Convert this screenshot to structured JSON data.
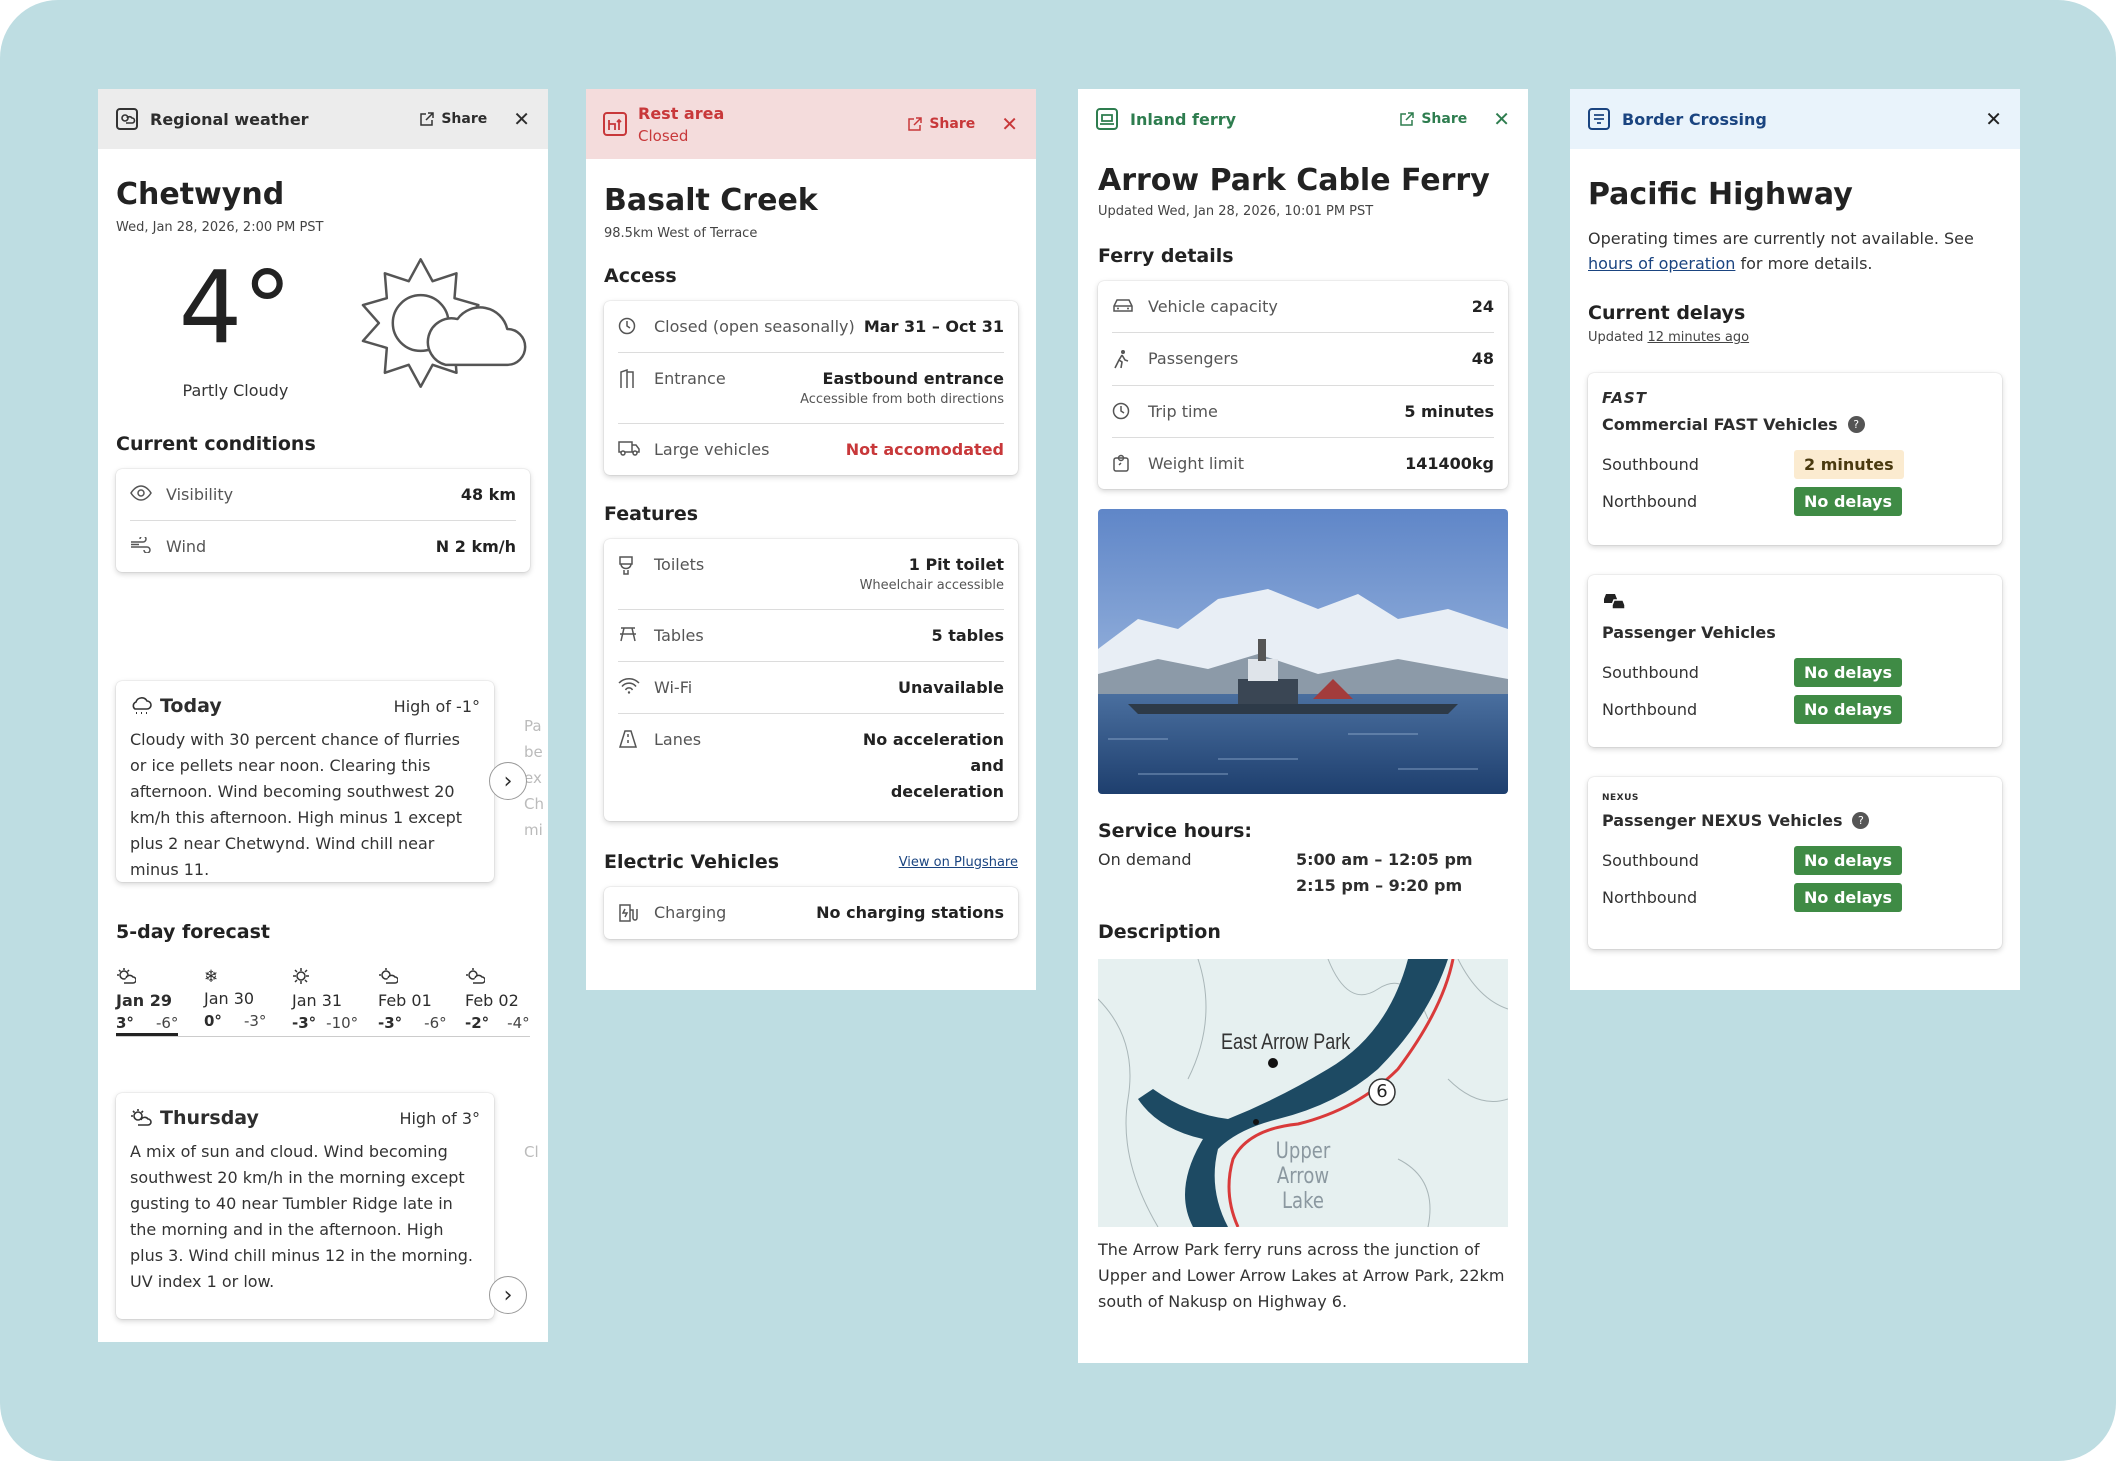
{
  "weather": {
    "header": "Regional weather",
    "share": "Share",
    "title": "Chetwynd",
    "date": "Wed, Jan 28, 2026, 2:00 PM PST",
    "temp": "4°",
    "condition": "Partly Cloudy",
    "conditions_title": "Current conditions",
    "rows": [
      {
        "label": "Visibility",
        "value": "48 km"
      },
      {
        "label": "Wind",
        "value": "N 2 km/h"
      }
    ],
    "today": {
      "title": "Today",
      "high": "High of -1°",
      "text": "Cloudy with 30 percent chance of flurries or ice pellets near noon. Clearing this afternoon. Wind becoming southwest 20 km/h this afternoon. High minus 1 except plus 2 near Chetwynd. Wind chill near minus 11.",
      "peek": "Pa be ex Ch mi"
    },
    "forecast_title": "5-day forecast",
    "days": [
      {
        "d": "Jan 29",
        "hi": "3°",
        "lo": "-6°"
      },
      {
        "d": "Jan 30",
        "hi": "0°",
        "lo": "-3°"
      },
      {
        "d": "Jan 31",
        "hi": "-3°",
        "lo": "-10°"
      },
      {
        "d": "Feb 01",
        "hi": "-3°",
        "lo": "-6°"
      },
      {
        "d": "Feb 02",
        "hi": "-2°",
        "lo": "-4°"
      }
    ],
    "thursday": {
      "title": "Thursday",
      "high": "High of 3°",
      "text": "A mix of sun and cloud. Wind becoming southwest 20 km/h in the morning except gusting to 40 near Tumbler Ridge late in the morning and in the afternoon. High plus 3. Wind chill minus 12 in the morning. UV index 1 or low.",
      "peek": "Cl"
    }
  },
  "rest": {
    "header": "Rest area",
    "status": "Closed",
    "share": "Share",
    "title": "Basalt Creek",
    "subtitle": "98.5km West of Terrace",
    "access_title": "Access",
    "access": [
      {
        "label": "Closed (open seasonally)",
        "value": "Mar 31 – Oct 31",
        "note": ""
      },
      {
        "label": "Entrance",
        "value": "Eastbound entrance",
        "note": "Accessible from both directions"
      },
      {
        "label": "Large vehicles",
        "value": "Not accomodated",
        "note": ""
      }
    ],
    "features_title": "Features",
    "features": [
      {
        "label": "Toilets",
        "value": "1 Pit toilet",
        "note": "Wheelchair accessible"
      },
      {
        "label": "Tables",
        "value": "5 tables",
        "note": ""
      },
      {
        "label": "Wi-Fi",
        "value": "Unavailable",
        "note": ""
      },
      {
        "label": "Lanes",
        "value": "No acceleration and deceleration",
        "note": ""
      }
    ],
    "ev_title": "Electric Vehicles",
    "ev_link": "View on Plugshare",
    "ev": {
      "label": "Charging",
      "value": "No charging stations"
    }
  },
  "ferry": {
    "header": "Inland ferry",
    "share": "Share",
    "title": "Arrow Park Cable Ferry",
    "updated": "Updated Wed, Jan 28, 2026, 10:01 PM PST",
    "details_title": "Ferry details",
    "details": [
      {
        "label": "Vehicle capacity",
        "value": "24"
      },
      {
        "label": "Passengers",
        "value": "48"
      },
      {
        "label": "Trip time",
        "value": "5 minutes"
      },
      {
        "label": "Weight limit",
        "value": "141400kg"
      }
    ],
    "hours_title": "Service hours:",
    "hours_label": "On demand",
    "hours": [
      "5:00 am – 12:05 pm",
      "2:15 pm – 9:20 pm"
    ],
    "desc_title": "Description",
    "map": {
      "east": "East Arrow Park",
      "upper": "Upper",
      "lake": "Arrow Lake",
      "route": "6"
    },
    "desc": "The Arrow Park ferry runs across the junction of Upper and Lower Arrow Lakes at Arrow Park, 22km south of Nakusp on Highway 6."
  },
  "border": {
    "header": "Border Crossing",
    "title": "Pacific Highway",
    "intro1": "Operating times are currently not available. See ",
    "intro_link": "hours of operation",
    "intro2": " for more details.",
    "delays_title": "Current delays",
    "updated_prefix": "Updated ",
    "updated_link": "12 minutes ago",
    "groups": [
      {
        "logo": "FAST",
        "name": "Commercial FAST Vehicles",
        "help": true,
        "south": "2 minutes",
        "north": "No delays",
        "south_style": "amber"
      },
      {
        "logo": "",
        "name": "Passenger Vehicles",
        "help": false,
        "south": "No delays",
        "north": "No delays",
        "south_style": "green"
      },
      {
        "logo": "NEXUS",
        "name": "Passenger NEXUS Vehicles",
        "help": true,
        "south": "No delays",
        "north": "No delays",
        "south_style": "green"
      }
    ],
    "southbound": "Southbound",
    "northbound": "Northbound"
  },
  "colors": {
    "background": "#bedde2",
    "rest_header": "#f4dcdc",
    "ferry_green": "#2e7d4f",
    "border_header": "#e9f3fb",
    "delay_green": "#3f8b45",
    "delay_amber": "#fbebd0"
  }
}
